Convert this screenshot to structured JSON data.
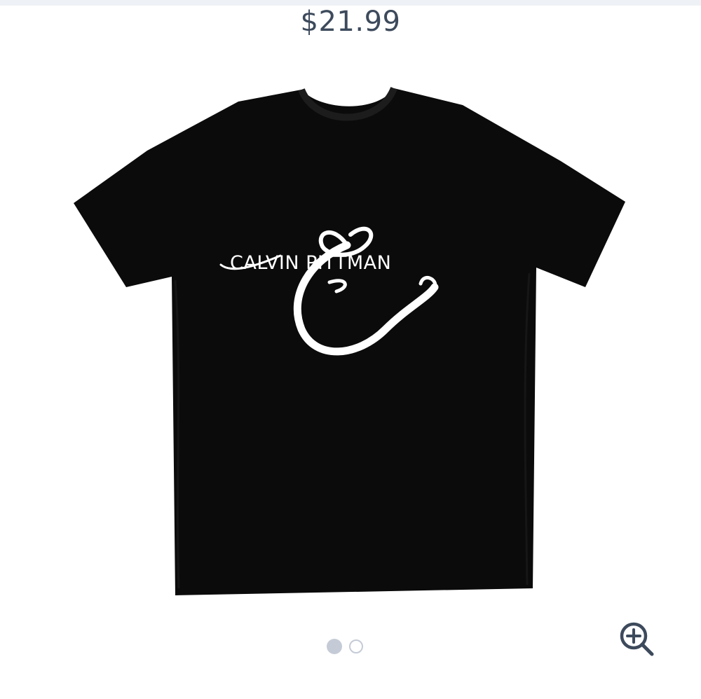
{
  "product": {
    "price": "$21.99",
    "design_text": "CALVIN PITTMAN",
    "shirt_color": "#0b0b0b",
    "print_color": "#ffffff"
  },
  "carousel": {
    "total_images": 2,
    "active_index": 1
  },
  "controls": {
    "zoom_icon": "zoom-in-icon"
  },
  "colors": {
    "price_text": "#3d4a5c",
    "dot": "#c5cbd6",
    "icon": "#3d4a5c"
  }
}
